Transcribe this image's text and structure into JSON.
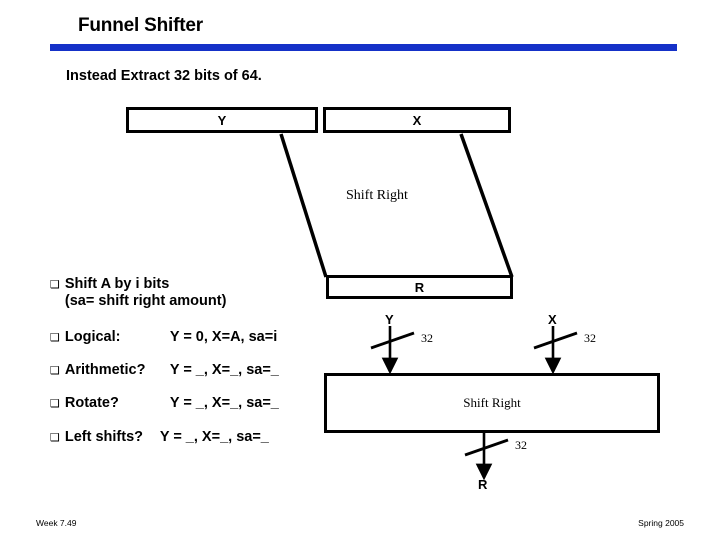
{
  "slide": {
    "title": "Funnel Shifter",
    "subtitle": "Instead Extract 32 bits of 64.",
    "accent_color": "#1531C8"
  },
  "funnel_diagram": {
    "input_left_label": "Y",
    "input_right_label": "X",
    "operation_label": "Shift Right",
    "output_label": "R"
  },
  "bullets": [
    {
      "marker": "❑",
      "line1": "Shift A by i bits",
      "line2": "(sa= shift right amount)"
    },
    {
      "marker": "❑",
      "label": "Logical:",
      "expr": "Y = 0,  X=A, sa=i"
    },
    {
      "marker": "❑",
      "label": "Arithmetic?",
      "expr": "Y = _,  X=_, sa=_"
    },
    {
      "marker": "❑",
      "label": "Rotate?",
      "expr": "Y = _,  X=_, sa=_"
    },
    {
      "marker": "❑",
      "label": "Left shifts?",
      "expr": "Y = _,  X=_, sa=_"
    }
  ],
  "shifter_block": {
    "input_left_label": "Y",
    "input_left_width": "32",
    "input_right_label": "X",
    "input_right_width": "32",
    "block_label": "Shift Right",
    "output_label": "R",
    "output_width": "32"
  },
  "footer": {
    "left": "Week 7.49",
    "right": "Spring 2005"
  }
}
